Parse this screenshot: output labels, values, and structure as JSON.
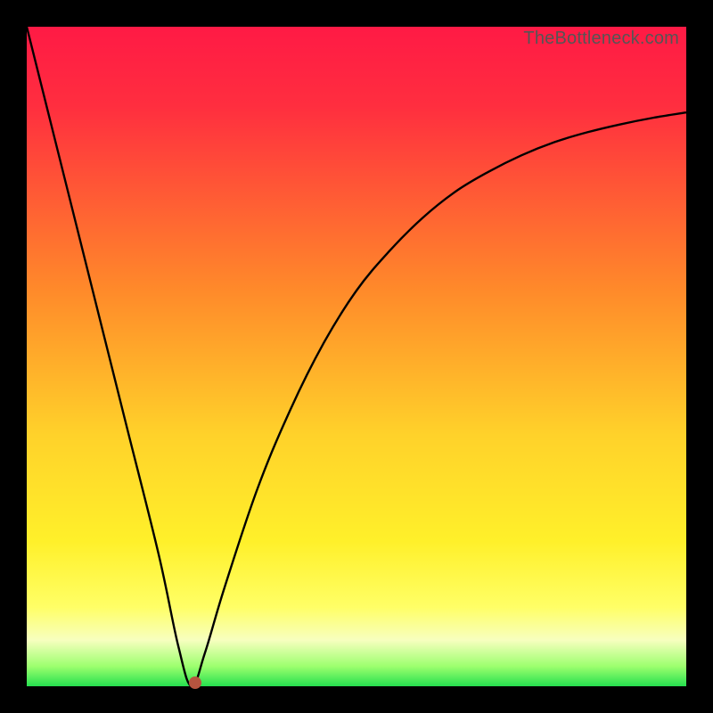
{
  "watermark": "TheBottleneck.com",
  "colors": {
    "red": "#ff1a45",
    "red2": "#ff2e3f",
    "orange": "#ff8a2a",
    "yellow": "#ffd22a",
    "yellow2": "#fff02a",
    "yellow3": "#ffff66",
    "pale": "#f7ffbf",
    "green1": "#9cff6e",
    "green2": "#26e04f",
    "curve": "#000000",
    "marker": "#b6543f"
  },
  "chart_data": {
    "type": "line",
    "title": "",
    "xlabel": "",
    "ylabel": "",
    "xlim": [
      0,
      100
    ],
    "ylim": [
      0,
      100
    ],
    "minimum_x": 25,
    "series": [
      {
        "name": "bottleneck-curve",
        "x": [
          0,
          5,
          10,
          15,
          20,
          23,
          25,
          27,
          30,
          35,
          40,
          45,
          50,
          55,
          60,
          65,
          70,
          75,
          80,
          85,
          90,
          95,
          100
        ],
        "values": [
          100,
          80,
          60,
          40,
          20,
          6,
          0,
          5,
          15,
          30,
          42,
          52,
          60,
          66,
          71,
          75,
          78,
          80.5,
          82.5,
          84,
          85.2,
          86.2,
          87
        ]
      }
    ],
    "marker": {
      "x": 25.5,
      "y": 0.5
    }
  }
}
